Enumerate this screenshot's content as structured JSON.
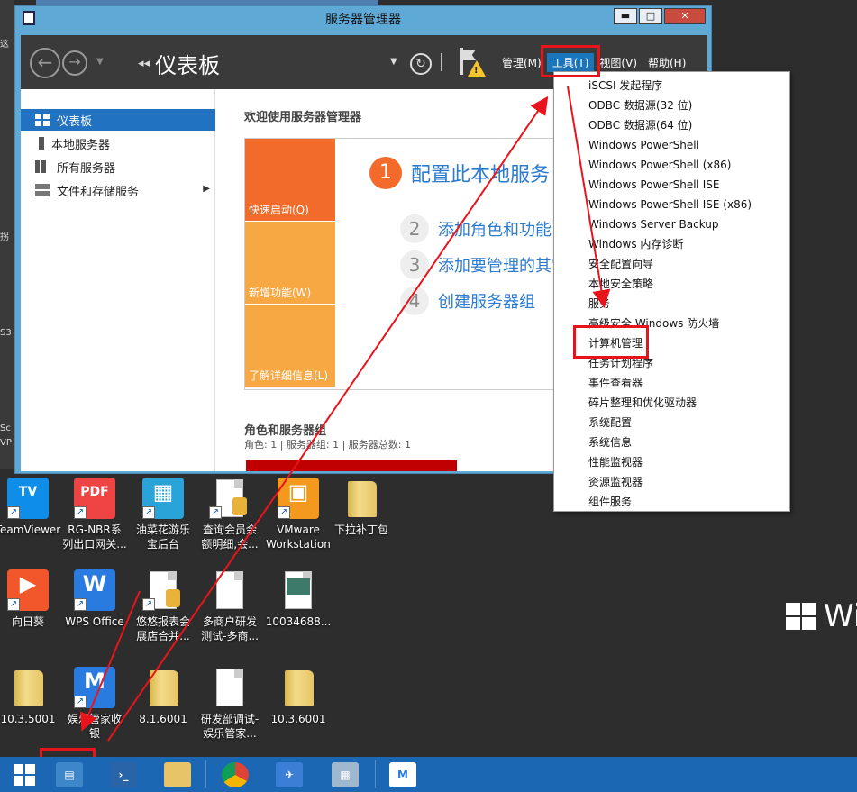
{
  "desktop": {
    "left_fragments": [
      "这",
      "拐",
      "S3",
      "Sc",
      "VP"
    ],
    "icons_row1": [
      {
        "label": "TeamViewer",
        "icon": "teamviewer-icon",
        "color": "#0e8ee9",
        "glyph": "TV"
      },
      {
        "label": "RG-NBR系\n列出口网关...",
        "icon": "pdf-icon",
        "color": "#e44",
        "glyph": "PDF"
      },
      {
        "label": "油菜花游乐\n宝后台",
        "icon": "app-icon",
        "color": "#2aa3d9",
        "glyph": "▦"
      },
      {
        "label": "查询会员余\n额明细,会...",
        "icon": "doc-db-icon",
        "color": "#ddd",
        "glyph": ""
      },
      {
        "label": "VMware\nWorkstation",
        "icon": "vmware-icon",
        "color": "#f39a1e",
        "glyph": "▣"
      },
      {
        "label": "下拉补丁包",
        "icon": "folder-icon",
        "color": "",
        "glyph": ""
      }
    ],
    "icons_row2": [
      {
        "label": "向日葵",
        "icon": "sunflower-icon",
        "color": "#f2572b",
        "glyph": "▶"
      },
      {
        "label": "WPS Office",
        "icon": "wps-icon",
        "color": "#2a7be0",
        "glyph": "W"
      },
      {
        "label": "悠悠报表会\n展店合并...",
        "icon": "doc-db-icon",
        "color": "#ddd",
        "glyph": ""
      },
      {
        "label": "多商户研发\n测试-多商...",
        "icon": "file-icon",
        "color": "",
        "glyph": ""
      },
      {
        "label": "10034688...",
        "icon": "image-file-icon",
        "color": "#ddd",
        "glyph": ""
      }
    ],
    "icons_row3": [
      {
        "label": "10.3.5001",
        "icon": "folder-icon",
        "color": "",
        "glyph": ""
      },
      {
        "label": "娱乐管家收\n银",
        "icon": "yule-icon",
        "color": "#2a7be0",
        "glyph": "M"
      },
      {
        "label": "8.1.6001",
        "icon": "folder-icon",
        "color": "",
        "glyph": ""
      },
      {
        "label": "研发部调试-\n娱乐管家...",
        "icon": "file-icon",
        "color": "",
        "glyph": ""
      },
      {
        "label": "10.3.6001",
        "icon": "folder-icon",
        "color": "",
        "glyph": ""
      }
    ],
    "win_brand": "Wi"
  },
  "window": {
    "title": "服务器管理器",
    "page_title": "仪表板",
    "menus": [
      {
        "label": "管理(M)",
        "active": false
      },
      {
        "label": "工具(T)",
        "active": true
      },
      {
        "label": "视图(V)",
        "active": false
      },
      {
        "label": "帮助(H)",
        "active": false
      }
    ],
    "sidebar": [
      {
        "label": "仪表板",
        "active": true
      },
      {
        "label": "本地服务器",
        "active": false
      },
      {
        "label": "所有服务器",
        "active": false
      },
      {
        "label": "文件和存储服务",
        "active": false
      }
    ],
    "welcome": "欢迎使用服务器管理器",
    "quick_tiles": [
      {
        "label": "快速启动(Q)",
        "color": "#f26b2a"
      },
      {
        "label": "新增功能(W)",
        "color": "#f7a843"
      },
      {
        "label": "了解详细信息(L)",
        "color": "#f7a843"
      }
    ],
    "steps": [
      {
        "num": "1",
        "label": "配置此本地服务"
      },
      {
        "num": "2",
        "label": "添加角色和功能"
      },
      {
        "num": "3",
        "label": "添加要管理的其它"
      },
      {
        "num": "4",
        "label": "创建服务器组"
      }
    ],
    "roles_title": "角色和服务器组",
    "roles_sub": "角色: 1 | 服务器组: 1 | 服务器总数: 1"
  },
  "tools_menu": [
    "iSCSI 发起程序",
    "ODBC 数据源(32 位)",
    "ODBC 数据源(64 位)",
    "Windows PowerShell",
    "Windows PowerShell (x86)",
    "Windows PowerShell ISE",
    "Windows PowerShell ISE (x86)",
    "Windows Server Backup",
    "Windows 内存诊断",
    "安全配置向导",
    "本地安全策略",
    "服务",
    "高级安全 Windows 防火墙",
    "计算机管理",
    "任务计划程序",
    "事件查看器",
    "碎片整理和优化驱动器",
    "系统配置",
    "系统信息",
    "性能监视器",
    "资源监视器",
    "组件服务"
  ],
  "colors": {
    "accent": "#2173c1",
    "highlight": "#e8141b",
    "taskbar": "#1b67b3"
  }
}
